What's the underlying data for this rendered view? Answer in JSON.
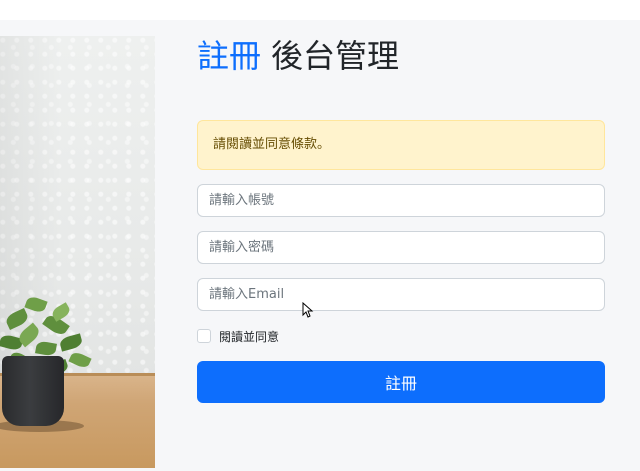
{
  "header": {
    "title_accent": "註冊",
    "title_rest": "後台管理"
  },
  "alert": {
    "message": "請閱讀並同意條款。"
  },
  "form": {
    "account_placeholder": "請輸入帳號",
    "password_placeholder": "請輸入密碼",
    "email_placeholder": "請輸入Email",
    "agree_label": "閱讀並同意",
    "submit_label": "註冊"
  },
  "colors": {
    "accent": "#0d6efd",
    "alert_bg": "#fff3cd",
    "alert_text": "#664d03",
    "page_bg": "#f6f7f9"
  },
  "icons": {
    "cursor": "mouse-pointer-icon"
  }
}
